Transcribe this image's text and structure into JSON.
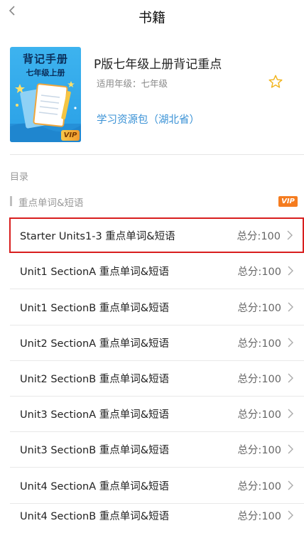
{
  "header": {
    "title": "书籍"
  },
  "book": {
    "cover_title_main": "背记手册",
    "cover_title_sub": "七年级上册",
    "cover_badge": "VIP",
    "name": "P版七年级上册背记重点",
    "grade_line": "适用年级：七年级",
    "resource_link": "学习资源包（湖北省）"
  },
  "toc": {
    "label": "目录",
    "section_title": "重点单词&短语",
    "section_badge": "VIP",
    "items": [
      {
        "title": "Starter Units1-3 重点单词&短语",
        "score": "总分:100"
      },
      {
        "title": "Unit1 SectionA 重点单词&短语",
        "score": "总分:100"
      },
      {
        "title": "Unit1 SectionB 重点单词&短语",
        "score": "总分:100"
      },
      {
        "title": "Unit2 SectionA 重点单词&短语",
        "score": "总分:100"
      },
      {
        "title": "Unit2 SectionB 重点单词&短语",
        "score": "总分:100"
      },
      {
        "title": "Unit3 SectionA 重点单词&短语",
        "score": "总分:100"
      },
      {
        "title": "Unit3 SectionB 重点单词&短语",
        "score": "总分:100"
      },
      {
        "title": "Unit4 SectionA 重点单词&短语",
        "score": "总分:100"
      },
      {
        "title": "Unit4 SectionB 重点单词&短语",
        "score": "总分:100"
      }
    ]
  },
  "colors": {
    "link": "#3a92d6",
    "highlight_border": "#d81e1e",
    "vip_orange": "#f57c1f",
    "star": "#f2b51e"
  },
  "icons": {
    "back": "chevron-left-icon",
    "favorite": "star-outline-icon",
    "row_arrow": "chevron-right-icon"
  }
}
